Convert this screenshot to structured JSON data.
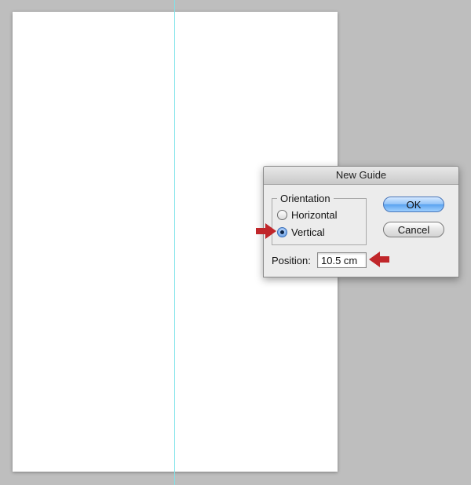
{
  "dialog": {
    "title": "New Guide",
    "orientation": {
      "legend": "Orientation",
      "options": [
        {
          "label": "Horizontal",
          "checked": false
        },
        {
          "label": "Vertical",
          "checked": true
        }
      ]
    },
    "position": {
      "label": "Position:",
      "value": "10.5 cm"
    },
    "buttons": {
      "ok": "OK",
      "cancel": "Cancel"
    }
  },
  "colors": {
    "workspace": "#bebebe",
    "canvas": "#ffffff",
    "guide": "#7fe3ea",
    "arrow": "#c0262a"
  },
  "icons": {
    "annotation": "red-arrow-icon"
  }
}
